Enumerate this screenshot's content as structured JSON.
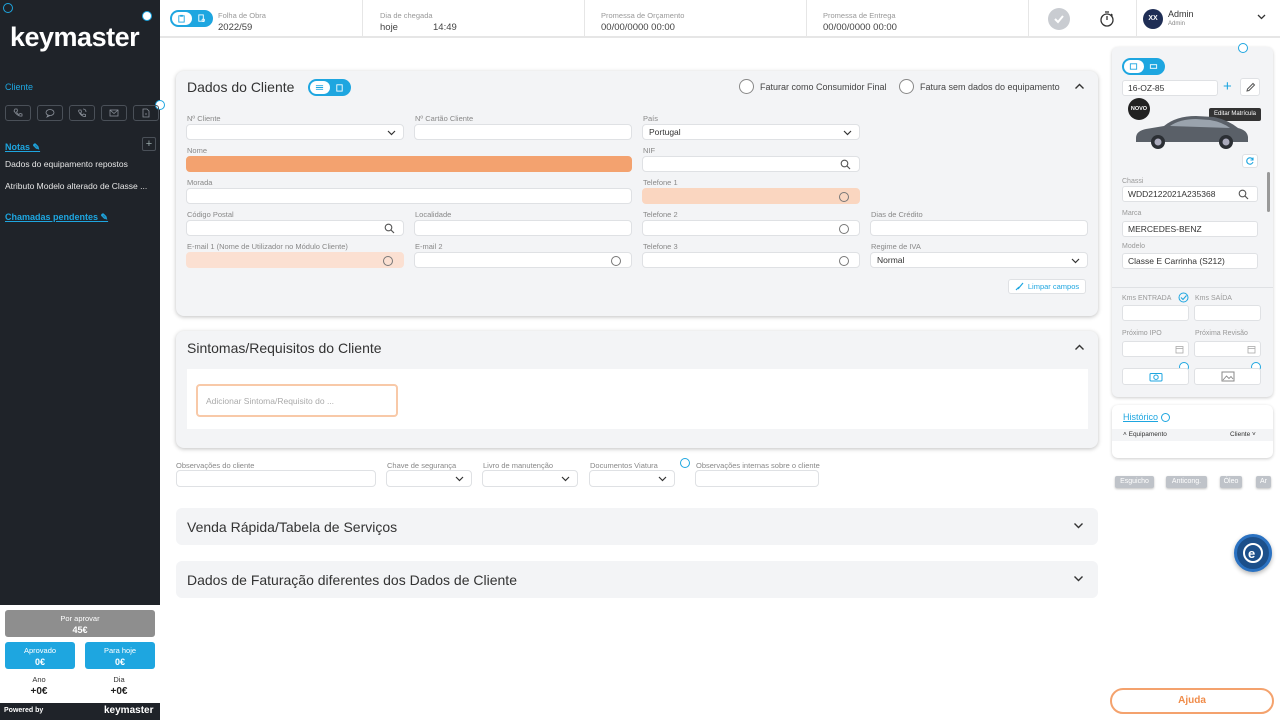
{
  "sidebar": {
    "logo": "keymaster",
    "cliente": "Cliente",
    "notas": "Notas",
    "notes": [
      "Dados do equipamento repostos",
      "Atributo Modelo alterado de Classe ..."
    ],
    "chamadas": "Chamadas pendentes",
    "icons": [
      "phone-icon",
      "chat-icon",
      "phone-call-icon",
      "mail-icon",
      "document-icon"
    ],
    "stats": {
      "por_aprovar_label": "Por aprovar",
      "por_aprovar_value": "45€",
      "aprovado_label": "Aprovado",
      "aprovado_value": "0€",
      "para_hoje_label": "Para hoje",
      "para_hoje_value": "0€",
      "ano_label": "Ano",
      "ano_value": "+0€",
      "dia_label": "Dia",
      "dia_value": "+0€"
    },
    "powered_by": "Powered by",
    "powered_logo": "keymaster"
  },
  "header": {
    "folha_label": "Folha de Obra",
    "folha_value": "2022/59",
    "dia_chegada_label": "Dia de chegada",
    "dia_chegada_value": "hoje",
    "hora_chegada": "14:49",
    "promessa_orcamento_label": "Promessa de Orçamento",
    "promessa_orcamento_value": "00/00/0000 00:00",
    "promessa_entrega_label": "Promessa de Entrega",
    "promessa_entrega_value": "00/00/0000 00:00",
    "user_initials": "XX",
    "user_name": "Admin",
    "user_role": "Admin"
  },
  "client": {
    "title": "Dados do Cliente",
    "faturar_consumidor": "Faturar como Consumidor Final",
    "fatura_sem_dados": "Fatura sem dados do equipamento",
    "n_cliente_label": "Nº Cliente",
    "n_cartao_label": "Nº Cartão Cliente",
    "pais_label": "País",
    "pais_value": "Portugal",
    "nome_label": "Nome",
    "nif_label": "NIF",
    "morada_label": "Morada",
    "telefone1_label": "Telefone 1",
    "codigo_postal_label": "Código Postal",
    "localidade_label": "Localidade",
    "telefone2_label": "Telefone 2",
    "dias_credito_label": "Dias de Crédito",
    "email1_label": "E-mail 1 (Nome de Utilizador no Módulo Cliente)",
    "email2_label": "E-mail 2",
    "telefone3_label": "Telefone 3",
    "regime_iva_label": "Regime de IVA",
    "regime_iva_value": "Normal",
    "limpar": "Limpar campos"
  },
  "symptoms": {
    "title": "Sintomas/Requisitos do Cliente",
    "placeholder": "Adicionar Sintoma/Requisito do ..."
  },
  "extras": {
    "observacoes_label": "Observações do cliente",
    "chave_label": "Chave de segurança",
    "livro_label": "Livro de manutenção",
    "documentos_label": "Documentos Viatura",
    "obs_internas_label": "Observações internas sobre o cliente"
  },
  "sections": {
    "venda_rapida": "Venda Rápida/Tabela de Serviços",
    "faturacao": "Dados de Faturação diferentes dos Dados de Cliente"
  },
  "vehicle": {
    "matricula": "16-OZ-85",
    "tooltip": "Editar Matrícula",
    "novo_badge": "NOVO",
    "chassi_label": "Chassi",
    "chassi_value": "WDD2122021A235368",
    "marca_label": "Marca",
    "marca_value": "MERCEDES-BENZ",
    "modelo_label": "Modelo",
    "modelo_value": "Classe E Carrinha (S212)",
    "kms_entrada_label": "Kms ENTRADA",
    "kms_saida_label": "Kms SAÍDA",
    "proximo_ipo_label": "Próximo IPO",
    "proxima_revisao_label": "Próxima Revisão"
  },
  "historico": {
    "title": "Histórico",
    "equipamento": "Equipamento",
    "cliente": "Cliente"
  },
  "chips": [
    "Esguicho",
    "Anticong.",
    "Óleo",
    "Ar"
  ],
  "ajuda": "Ajuda",
  "colors": {
    "accent": "#1ea6e0",
    "sidebar_bg": "#1f2329",
    "required_orange": "#f3a26f",
    "ajuda_orange": "#f4a26d"
  }
}
